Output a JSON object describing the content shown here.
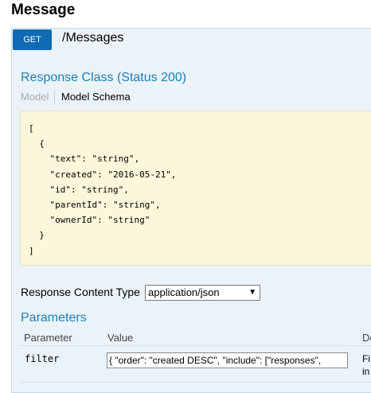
{
  "section": {
    "title": "Message"
  },
  "operation": {
    "method": "GET",
    "path": "/Messages"
  },
  "response": {
    "class_title": "Response Class (Status 200)",
    "tabs": [
      {
        "label": "Model",
        "active": false
      },
      {
        "label": "Model Schema",
        "active": true
      }
    ],
    "schema_text": "[\n  {\n    \"text\": \"string\",\n    \"created\": \"2016-05-21\",\n    \"id\": \"string\",\n    \"parentId\": \"string\",\n    \"ownerId\": \"string\"\n  }\n]"
  },
  "content_type": {
    "label": "Response Content Type",
    "selected": "application/json",
    "arrow_icon": "triangle-down"
  },
  "parameters": {
    "title": "Parameters",
    "columns": {
      "parameter": "Parameter",
      "value": "Value",
      "description": "De"
    },
    "rows": [
      {
        "name": "filter",
        "value": "{ \"order\":  \"created DESC\", \"include\": [\"responses\",",
        "description_line1": "Fi",
        "description_line2": "in"
      }
    ]
  },
  "colors": {
    "method_get": "#0f6ab4",
    "link_blue": "#1d7fb8",
    "panel_bg": "#ebf3f9",
    "schema_bg": "#fcf6db"
  }
}
